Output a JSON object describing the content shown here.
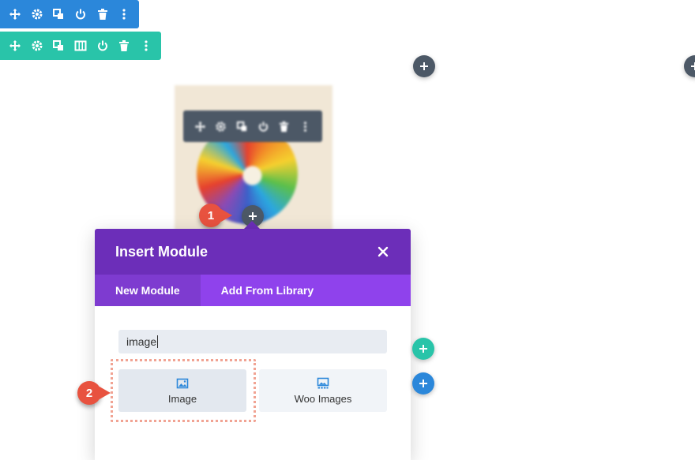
{
  "toolbars": {
    "section": {
      "icons": [
        "move-icon",
        "gear-icon",
        "duplicate-icon",
        "power-icon",
        "trash-icon",
        "more-icon"
      ],
      "color": "#2b87da"
    },
    "row": {
      "icons": [
        "move-icon",
        "gear-icon",
        "duplicate-icon",
        "columns-icon",
        "power-icon",
        "trash-icon",
        "more-icon"
      ],
      "color": "#29c4a9"
    }
  },
  "module_toolbar": {
    "icons": [
      "move-icon",
      "gear-icon",
      "duplicate-icon",
      "power-icon",
      "trash-icon",
      "more-icon"
    ]
  },
  "callouts": {
    "one": "1",
    "two": "2"
  },
  "modal": {
    "title": "Insert Module",
    "tabs": [
      {
        "label": "New Module",
        "active": true
      },
      {
        "label": "Add From Library",
        "active": false
      }
    ],
    "search_value": "image",
    "modules": [
      {
        "label": "Image",
        "icon": "image-icon",
        "selected": true
      },
      {
        "label": "Woo Images",
        "icon": "gallery-icon",
        "selected": false
      }
    ]
  },
  "colors": {
    "purple_header": "#6c2eb9",
    "purple_tabs": "#8f42ec",
    "callout": "#e8523f",
    "dark_button": "#4c5866"
  }
}
